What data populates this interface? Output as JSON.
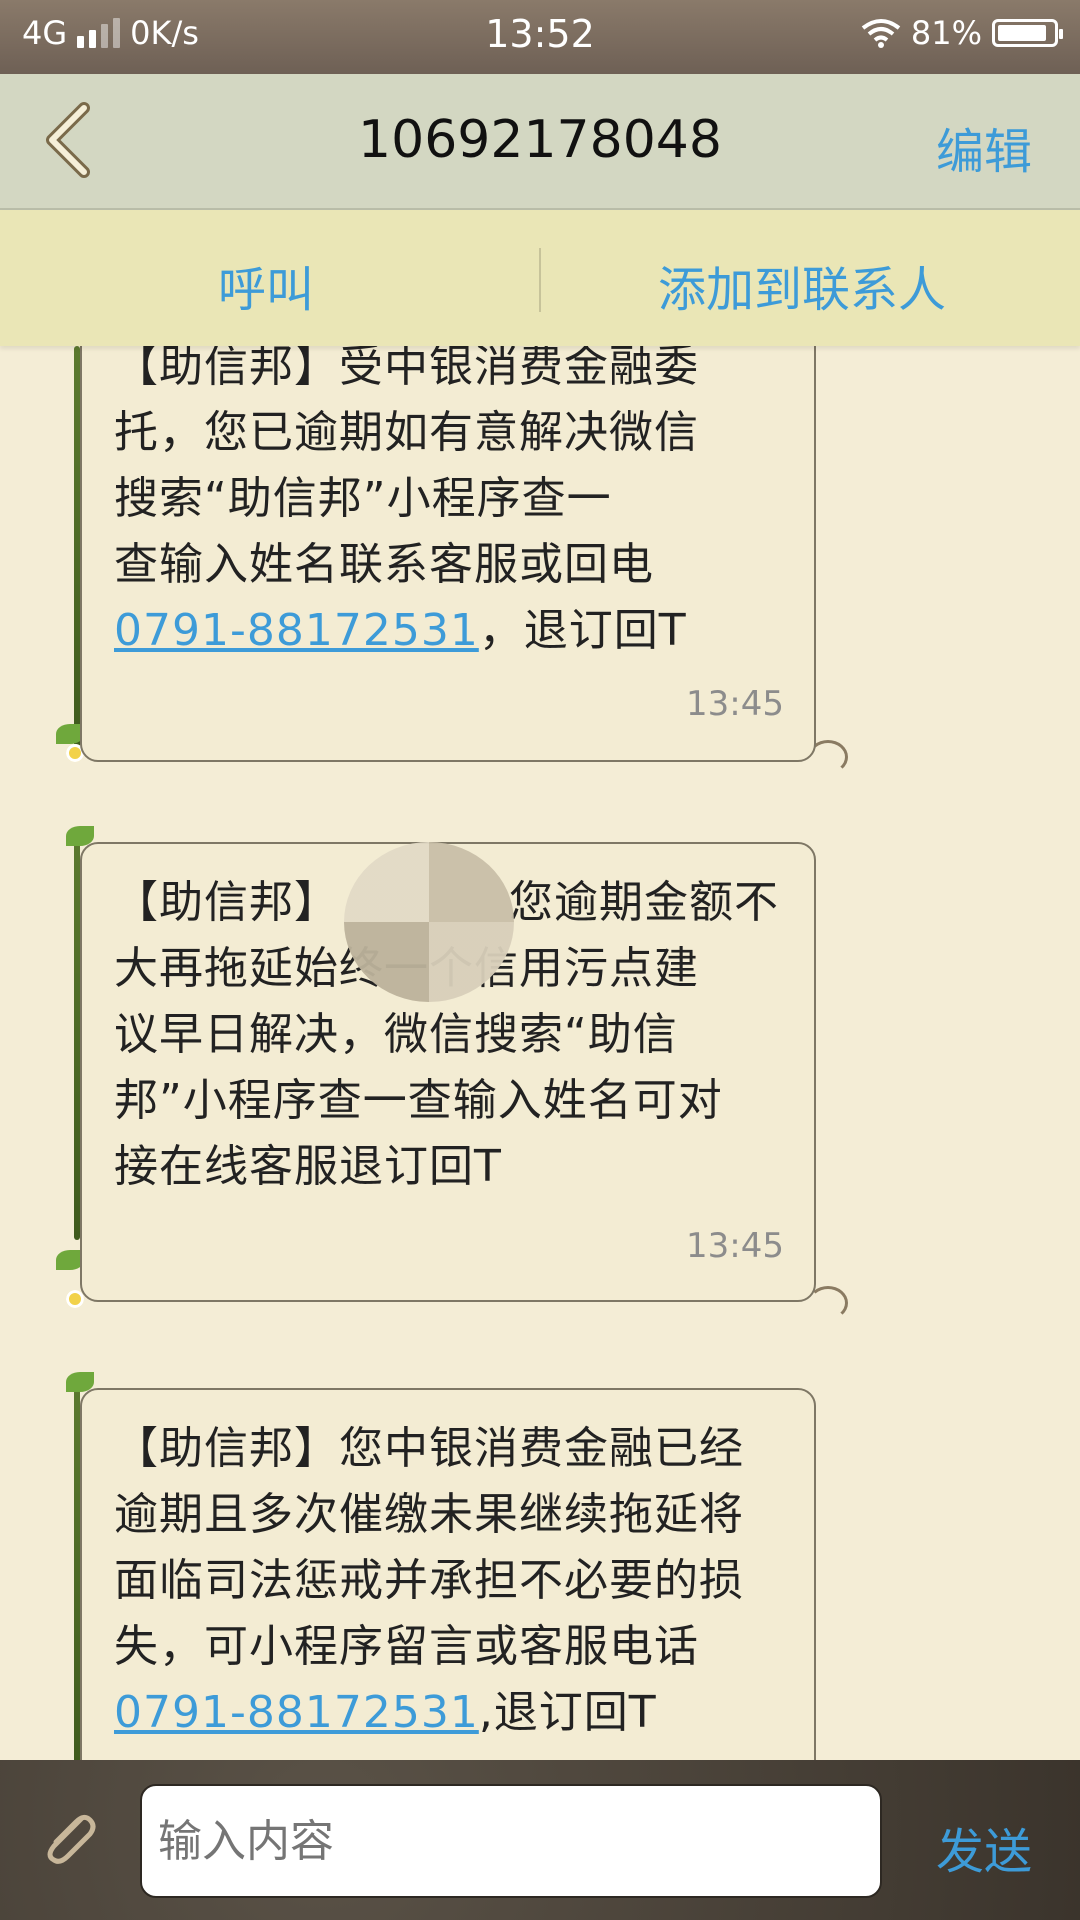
{
  "status": {
    "network": "4G",
    "speed": "0K/s",
    "time": "13:52",
    "battery": "81%"
  },
  "nav": {
    "title": "10692178048",
    "edit_label": "编辑"
  },
  "actions": {
    "call": "呼叫",
    "add_contact": "添加到联系人"
  },
  "messages": [
    {
      "lines": [
        "【助信邦】受中银消费金融委",
        "托，您已逾期如有意解决微信",
        "搜索“助信邦”小程序查一",
        "查输入姓名联系客服或回电"
      ],
      "phone": "0791-88172531",
      "after_phone": "，退订回T",
      "time": "13:45"
    },
    {
      "lines": [
        "【助信邦】",
        "您逾期金额不",
        "大再拖延始终",
        "一个信用污点建",
        "议早日解决，微信搜索“助信",
        "邦”小程序查一查输入姓名可对",
        "接在线客服退订回T"
      ],
      "time": "13:45"
    },
    {
      "lines": [
        "【助信邦】您中银消费金融已经",
        "逾期且多次催缴未果继续拖延将",
        "面临司法惩戒并承担不必要的损",
        "失，可小程序留言或客服电话"
      ],
      "phone": "0791-88172531",
      "after_phone": ",退订回T"
    }
  ],
  "input": {
    "placeholder": "输入内容",
    "send_label": "发送"
  }
}
